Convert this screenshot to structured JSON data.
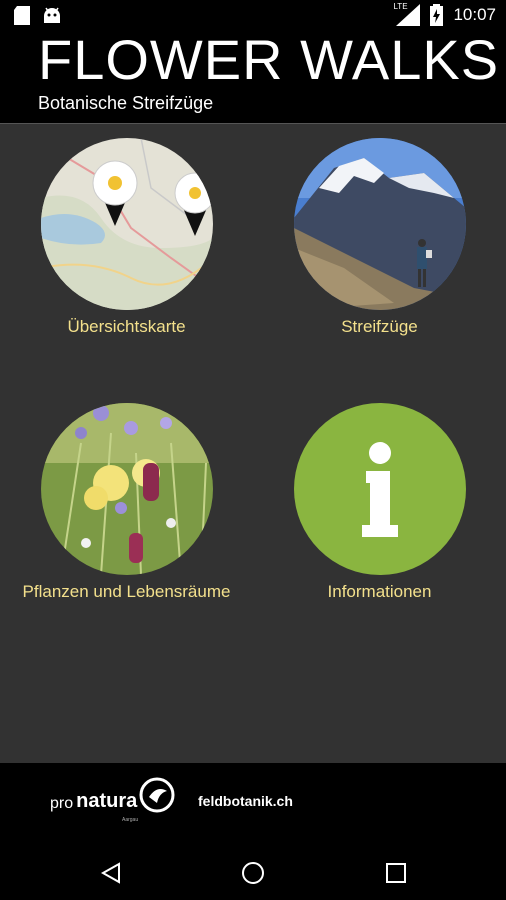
{
  "status_bar": {
    "time": "10:07",
    "network_label": "LTE",
    "icons": [
      "sd-card-icon",
      "android-icon",
      "signal-icon",
      "battery-charging-icon"
    ]
  },
  "header": {
    "title": "FLOWER WALKS",
    "subtitle": "Botanische Streifzüge"
  },
  "tiles": [
    {
      "label": "Übersichtskarte",
      "image": "map-with-flower-pins"
    },
    {
      "label": "Streifzüge",
      "image": "mountain-hiker-photo"
    },
    {
      "label": "Pflanzen und Lebensräume",
      "image": "wildflower-meadow-photo"
    },
    {
      "label": "Informationen",
      "image": "info-icon"
    }
  ],
  "footer": {
    "logo_pro": "pro",
    "logo_natura": "natura",
    "logo_sub": "Aargau",
    "website": "feldbotanik.ch"
  },
  "colors": {
    "label": "#f3e08c",
    "panel": "#323232",
    "info_green": "#8ab540"
  },
  "nav": [
    "back-icon",
    "home-icon",
    "recents-icon"
  ]
}
